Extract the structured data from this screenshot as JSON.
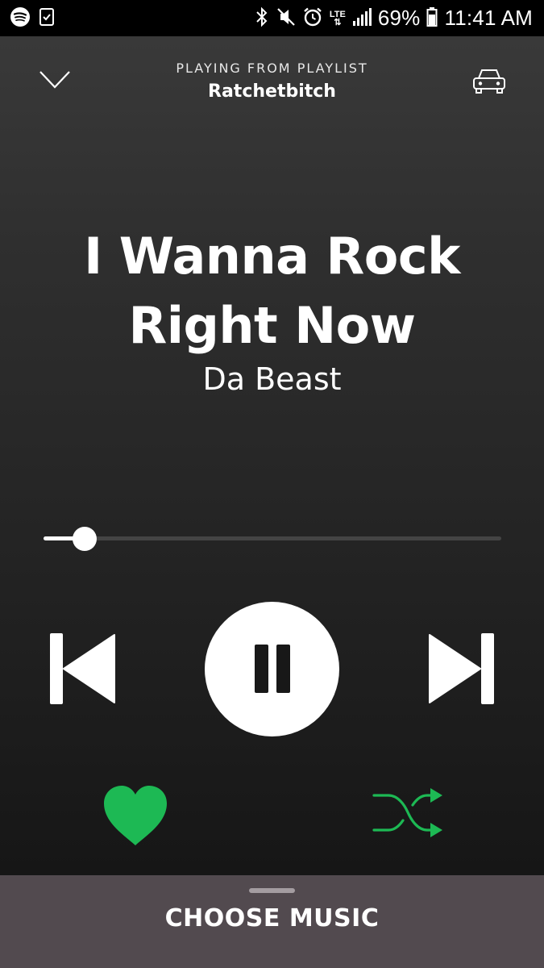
{
  "status_bar": {
    "battery": "69%",
    "time": "11:41 AM",
    "network": "LTE",
    "icons_left": [
      "spotify-icon",
      "clipboard-check-icon"
    ],
    "icons_right": [
      "bluetooth-icon",
      "mute-icon",
      "alarm-icon",
      "lte-icon",
      "signal-icon",
      "battery-icon"
    ]
  },
  "header": {
    "context_label": "PLAYING FROM PLAYLIST",
    "playlist_name": "Ratchetbitch",
    "left_icon": "chevron-down-icon",
    "right_icon": "car-icon"
  },
  "track": {
    "title": "I Wanna Rock Right Now",
    "artist": "Da Beast"
  },
  "progress": {
    "fraction": 0.09
  },
  "controls": {
    "prev_icon": "skip-previous-icon",
    "play_state_icon": "pause-icon",
    "next_icon": "skip-next-icon",
    "liked": true,
    "shuffle": true
  },
  "bottom_bar": {
    "label": "CHOOSE MUSIC"
  },
  "colors": {
    "accent": "#1db954",
    "background": "#2a2a2a",
    "bottom_bar": "#524a4f"
  }
}
